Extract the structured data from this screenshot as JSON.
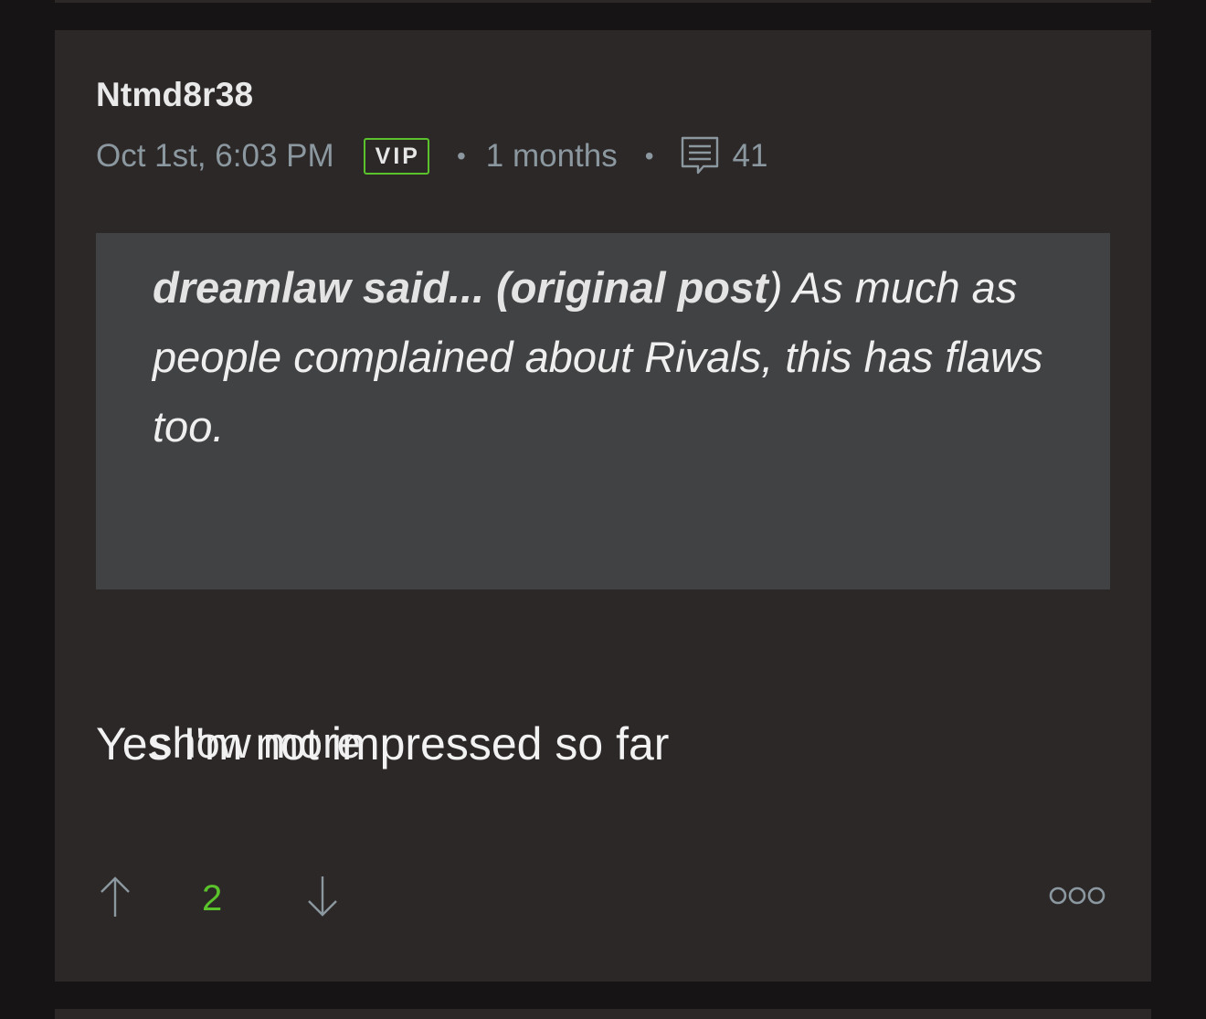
{
  "post": {
    "username": "Ntmd8r38",
    "timestamp": "Oct 1st, 6:03 PM",
    "badge": "VIP",
    "separator": "•",
    "age": "1 months",
    "reply_count": "41",
    "quote": {
      "author_label": "dreamlaw said... (original post",
      "close_paren": ")",
      "text": " As much as people complained about Rivals, this has flaws too.",
      "show_more_label": "show more"
    },
    "body": "Yes I'm not impressed so far",
    "votes": "2"
  },
  "icons": {
    "comment": "comment-icon",
    "upvote": "arrow-up-icon",
    "downvote": "arrow-down-icon",
    "more": "more-options-icon"
  },
  "colors": {
    "accent_green": "#5ac22a",
    "card_background": "#2c2827",
    "page_background": "#171415",
    "quote_background": "#414244",
    "meta_text": "#8c98a0"
  }
}
